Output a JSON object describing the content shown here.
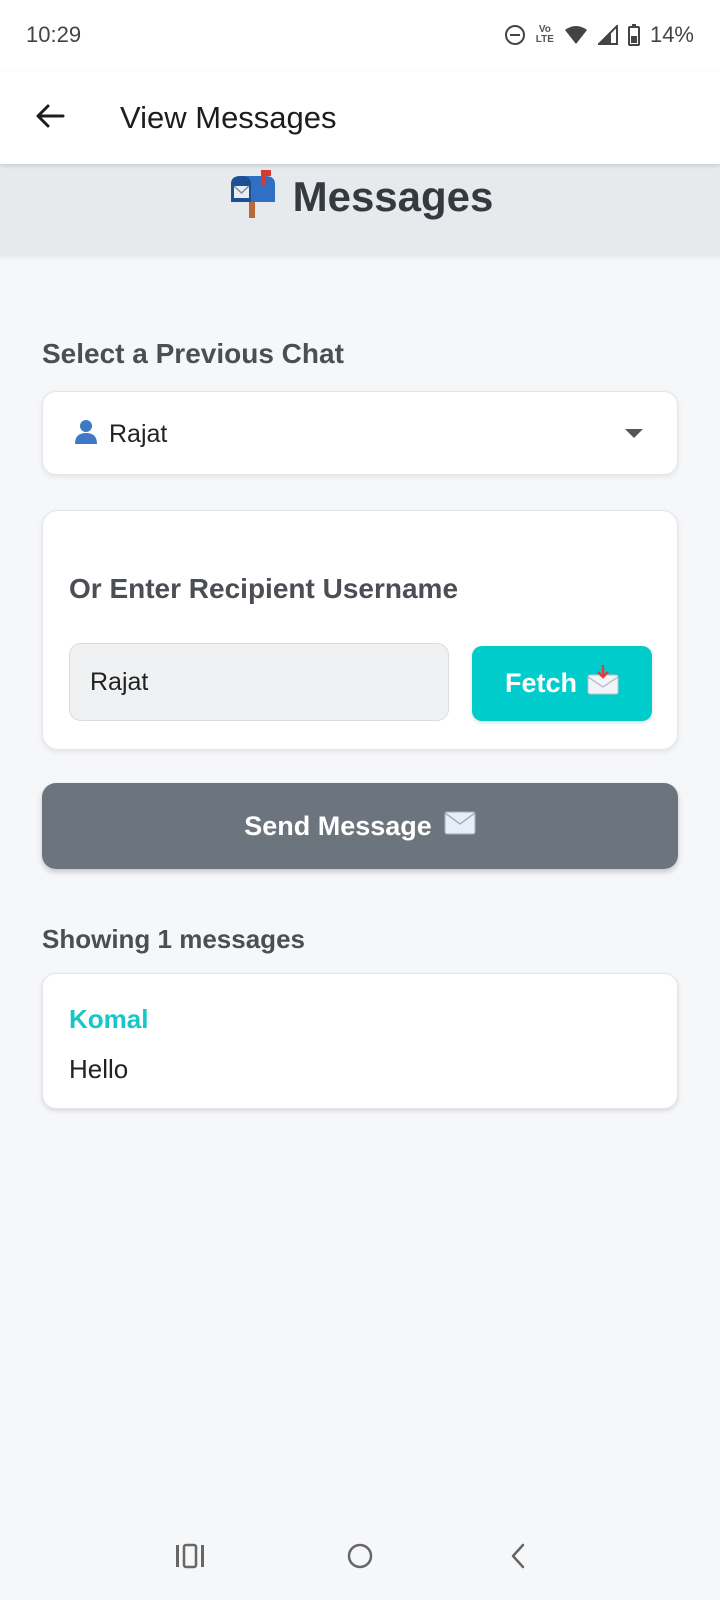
{
  "status_bar": {
    "time": "10:29",
    "network_label": "Vo LTE",
    "battery": "14%"
  },
  "appbar": {
    "title": "View Messages",
    "back_icon": "arrow-left-icon"
  },
  "header": {
    "icon": "mailbox-icon",
    "title": "Messages"
  },
  "previous_chat": {
    "label": "Select a Previous Chat",
    "selected": "Rajat",
    "user_icon": "user-icon"
  },
  "recipient": {
    "label": "Or Enter Recipient Username",
    "value": "Rajat",
    "fetch_label": "Fetch",
    "fetch_icon": "incoming-envelope-icon"
  },
  "send": {
    "label": "Send Message",
    "icon": "envelope-icon"
  },
  "messages": {
    "summary": "Showing 1 messages",
    "items": [
      {
        "sender": "Komal",
        "text": "Hello"
      }
    ]
  },
  "colors": {
    "accent": "#00cccc",
    "sender": "#19c6c6",
    "send_button": "#6c757d",
    "header_band": "#e7eaed"
  },
  "nav_bar": {
    "icons": [
      "recent-apps-icon",
      "home-icon",
      "back-icon"
    ]
  }
}
